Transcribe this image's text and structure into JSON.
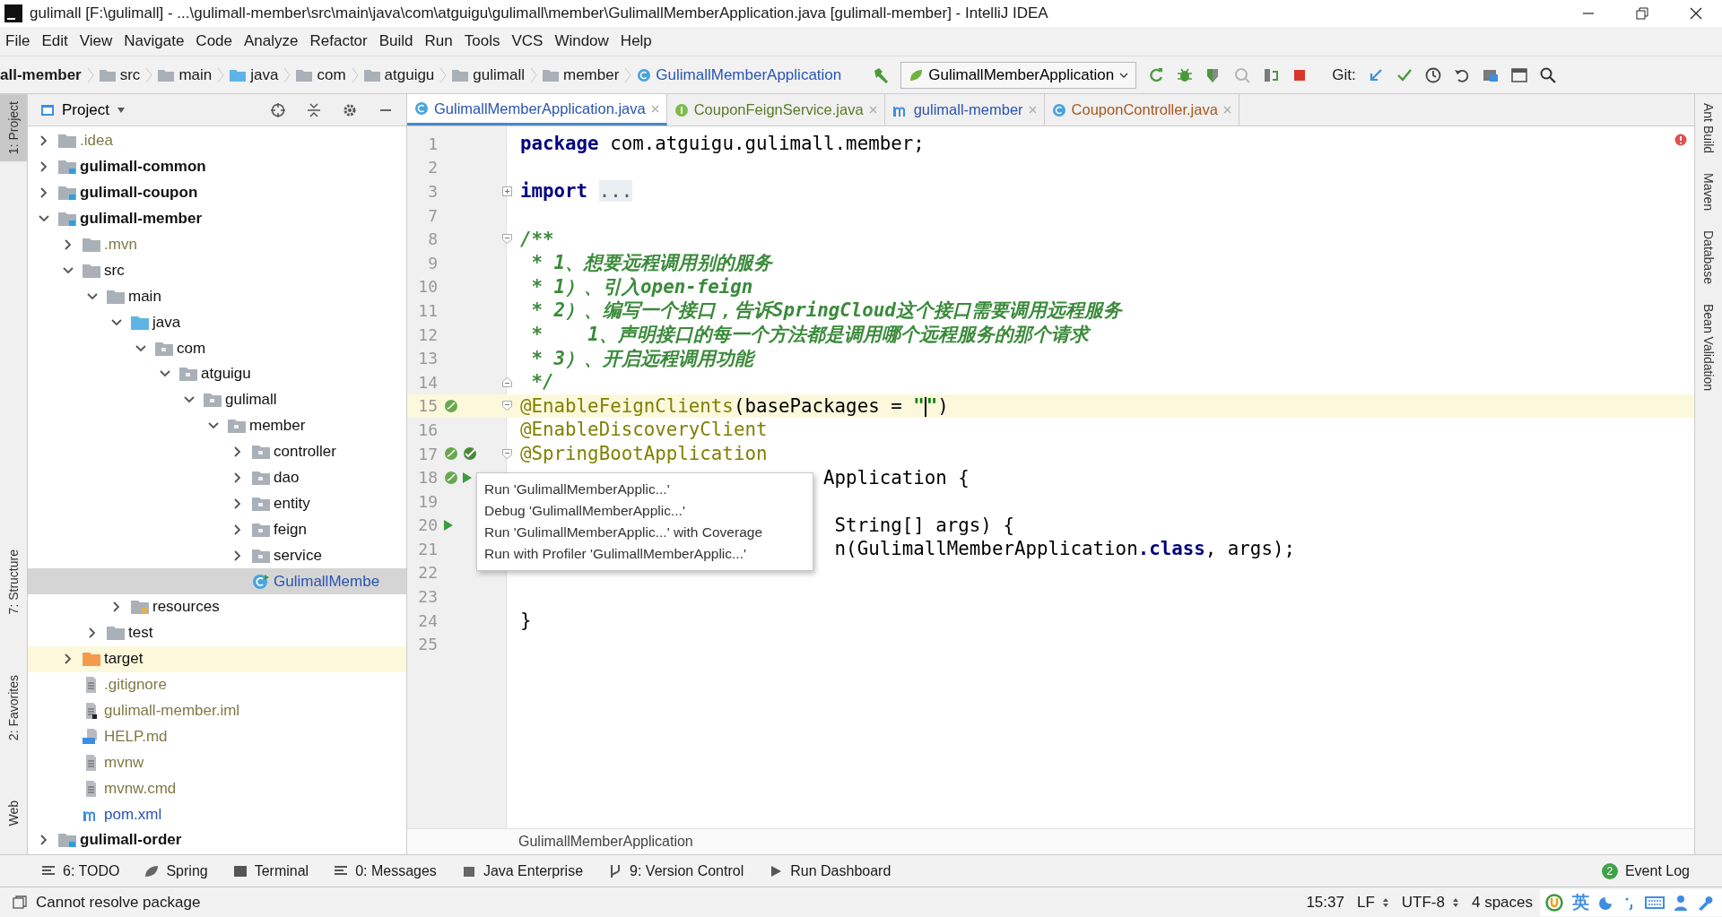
{
  "window": {
    "title": "gulimall [F:\\gulimall] - ...\\gulimall-member\\src\\main\\java\\com\\atguigu\\gulimall\\member\\GulimallMemberApplication.java [gulimall-member] - IntelliJ IDEA"
  },
  "menu": [
    "File",
    "Edit",
    "View",
    "Navigate",
    "Code",
    "Analyze",
    "Refactor",
    "Build",
    "Run",
    "Tools",
    "VCS",
    "Window",
    "Help"
  ],
  "breadcrumbs": [
    {
      "label": "all-member",
      "kind": "module"
    },
    {
      "label": "src",
      "kind": "folder"
    },
    {
      "label": "main",
      "kind": "folder"
    },
    {
      "label": "java",
      "kind": "source"
    },
    {
      "label": "com",
      "kind": "package"
    },
    {
      "label": "atguigu",
      "kind": "package"
    },
    {
      "label": "gulimall",
      "kind": "package"
    },
    {
      "label": "member",
      "kind": "package"
    },
    {
      "label": "GulimallMemberApplication",
      "kind": "class"
    }
  ],
  "run_config": "GulimallMemberApplication",
  "git_label": "Git:",
  "left_tools": [
    {
      "label": "1: Project",
      "selected": true
    },
    {
      "label": "7: Structure",
      "selected": false
    },
    {
      "label": "2: Favorites",
      "selected": false
    },
    {
      "label": "Web",
      "selected": false
    }
  ],
  "right_tools": [
    "Ant Build",
    "Maven",
    "Database",
    "Bean Validation"
  ],
  "project": {
    "title": "Project",
    "tree": [
      {
        "label": ".idea",
        "kind": "folder",
        "color": "#7f7a45",
        "expanded": false,
        "selected": false,
        "highlighted": false
      },
      {
        "label": "gulimall-common",
        "kind": "module",
        "color": "#111111",
        "expanded": false,
        "selected": false,
        "highlighted": false
      },
      {
        "label": "gulimall-coupon",
        "kind": "module",
        "color": "#111111",
        "expanded": false,
        "selected": false,
        "highlighted": false
      },
      {
        "label": "gulimall-member",
        "kind": "module",
        "color": "#111111",
        "expanded": true,
        "selected": false,
        "highlighted": false,
        "children": [
          {
            "label": ".mvn",
            "kind": "folder",
            "color": "#7f7a45",
            "expanded": false,
            "selected": false,
            "highlighted": false
          },
          {
            "label": "src",
            "kind": "folder",
            "color": "#111111",
            "expanded": true,
            "selected": false,
            "highlighted": false,
            "children": [
              {
                "label": "main",
                "kind": "folder",
                "color": "#111111",
                "expanded": true,
                "selected": false,
                "highlighted": false,
                "children": [
                  {
                    "label": "java",
                    "kind": "source",
                    "color": "#111111",
                    "expanded": true,
                    "selected": false,
                    "highlighted": false,
                    "children": [
                      {
                        "label": "com",
                        "kind": "package",
                        "color": "#111111",
                        "expanded": true,
                        "selected": false,
                        "highlighted": false,
                        "children": [
                          {
                            "label": "atguigu",
                            "kind": "package",
                            "color": "#111111",
                            "expanded": true,
                            "selected": false,
                            "highlighted": false,
                            "children": [
                              {
                                "label": "gulimall",
                                "kind": "package",
                                "color": "#111111",
                                "expanded": true,
                                "selected": false,
                                "highlighted": false,
                                "children": [
                                  {
                                    "label": "member",
                                    "kind": "package",
                                    "color": "#111111",
                                    "expanded": true,
                                    "selected": false,
                                    "highlighted": false,
                                    "children": [
                                      {
                                        "label": "controller",
                                        "kind": "package",
                                        "color": "#111111",
                                        "expanded": false,
                                        "selected": false,
                                        "highlighted": false
                                      },
                                      {
                                        "label": "dao",
                                        "kind": "package",
                                        "color": "#111111",
                                        "expanded": false,
                                        "selected": false,
                                        "highlighted": false
                                      },
                                      {
                                        "label": "entity",
                                        "kind": "package",
                                        "color": "#111111",
                                        "expanded": false,
                                        "selected": false,
                                        "highlighted": false
                                      },
                                      {
                                        "label": "feign",
                                        "kind": "package",
                                        "color": "#111111",
                                        "expanded": false,
                                        "selected": false,
                                        "highlighted": false
                                      },
                                      {
                                        "label": "service",
                                        "kind": "package",
                                        "color": "#111111",
                                        "expanded": false,
                                        "selected": false,
                                        "highlighted": false
                                      },
                                      {
                                        "label": "GulimallMembe",
                                        "kind": "class",
                                        "color": "#2a55b0",
                                        "selected": true,
                                        "highlighted": false
                                      }
                                    ]
                                  }
                                ]
                              }
                            ]
                          }
                        ]
                      }
                    ]
                  },
                  {
                    "label": "resources",
                    "kind": "resources",
                    "color": "#111111",
                    "expanded": false,
                    "selected": false,
                    "highlighted": false
                  }
                ]
              },
              {
                "label": "test",
                "kind": "folder",
                "color": "#111111",
                "expanded": false,
                "selected": false,
                "highlighted": false
              }
            ]
          },
          {
            "label": "target",
            "kind": "excluded",
            "color": "#111111",
            "expanded": false,
            "selected": false,
            "highlighted": true
          },
          {
            "label": ".gitignore",
            "kind": "file",
            "color": "#7f7a45",
            "selected": false,
            "highlighted": false
          },
          {
            "label": "gulimall-member.iml",
            "kind": "iml",
            "color": "#7f7a45",
            "selected": false,
            "highlighted": false
          },
          {
            "label": "HELP.md",
            "kind": "markdown",
            "color": "#7f7a45",
            "selected": false,
            "highlighted": false
          },
          {
            "label": "mvnw",
            "kind": "file",
            "color": "#7f7a45",
            "selected": false,
            "highlighted": false
          },
          {
            "label": "mvnw.cmd",
            "kind": "file",
            "color": "#7f7a45",
            "selected": false,
            "highlighted": false
          },
          {
            "label": "pom.xml",
            "kind": "maven",
            "color": "#2a55b0",
            "selected": false,
            "highlighted": false
          }
        ]
      },
      {
        "label": "gulimall-order",
        "kind": "module",
        "color": "#111111",
        "expanded": false,
        "selected": false,
        "highlighted": false
      }
    ]
  },
  "tabs": [
    {
      "label": "GulimallMemberApplication.java",
      "kind": "class",
      "color": "#2a55b0",
      "selected": true
    },
    {
      "label": "CouponFeignService.java",
      "kind": "interface",
      "color": "#5a7a2a",
      "selected": false
    },
    {
      "label": "gulimall-member",
      "kind": "maven",
      "color": "#2a55b0",
      "selected": false
    },
    {
      "label": "CouponController.java",
      "kind": "class",
      "color": "#a8571f",
      "selected": false
    }
  ],
  "code": [
    {
      "number": "1",
      "current": false,
      "segments": [
        {
          "kind": "keyword",
          "text": "package"
        },
        {
          "kind": "plain",
          "text": " com.atguigu.gulimall.member;"
        }
      ]
    },
    {
      "number": "2",
      "current": false
    },
    {
      "number": "3",
      "current": false,
      "segments": [
        {
          "kind": "keyword",
          "text": "import"
        },
        {
          "kind": "folded",
          "text": "..."
        }
      ]
    },
    {
      "number": "7",
      "current": false
    },
    {
      "number": "8",
      "current": false,
      "segments": [
        {
          "kind": "comment",
          "text": "/**"
        }
      ]
    },
    {
      "number": "9",
      "current": false,
      "segments": [
        {
          "kind": "comment",
          "text": " * 1、想要远程调用别的服务"
        }
      ]
    },
    {
      "number": "10",
      "current": false,
      "segments": [
        {
          "kind": "comment",
          "text": " * 1）、引入open-feign"
        }
      ]
    },
    {
      "number": "11",
      "current": false,
      "segments": [
        {
          "kind": "comment",
          "text": " * 2）、编写一个接口，告诉SpringCloud这个接口需要调用远程服务"
        }
      ]
    },
    {
      "number": "12",
      "current": false,
      "segments": [
        {
          "kind": "comment",
          "text": " *    1、声明接口的每一个方法都是调用哪个远程服务的那个请求"
        }
      ]
    },
    {
      "number": "13",
      "current": false,
      "segments": [
        {
          "kind": "comment",
          "text": " * 3）、开启远程调用功能"
        }
      ]
    },
    {
      "number": "14",
      "current": false,
      "segments": [
        {
          "kind": "comment",
          "text": " */"
        }
      ]
    },
    {
      "number": "15",
      "current": true,
      "segments": [
        {
          "kind": "annotation",
          "text": "@EnableFeignClients"
        },
        {
          "kind": "plain",
          "text": "(basePackages = "
        },
        {
          "kind": "string",
          "text": "\""
        },
        {
          "kind": "caret"
        },
        {
          "kind": "string",
          "text": "\""
        },
        {
          "kind": "plain",
          "text": ")"
        }
      ]
    },
    {
      "number": "16",
      "current": false,
      "segments": [
        {
          "kind": "annotation",
          "text": "@EnableDiscoveryClient"
        }
      ]
    },
    {
      "number": "17",
      "current": false,
      "segments": [
        {
          "kind": "annotation",
          "text": "@SpringBootApplication"
        }
      ]
    },
    {
      "number": "18",
      "current": false,
      "segments": [
        {
          "kind": "plain",
          "text": "                           Application {"
        }
      ]
    },
    {
      "number": "19",
      "current": false
    },
    {
      "number": "20",
      "current": false,
      "segments": [
        {
          "kind": "plain",
          "text": "                            String[] args) {"
        }
      ]
    },
    {
      "number": "21",
      "current": false,
      "segments": [
        {
          "kind": "plain",
          "text": "                            n(GulimallMemberApplication"
        },
        {
          "kind": "keyword",
          "text": ".class"
        },
        {
          "kind": "plain",
          "text": ", args);"
        }
      ]
    },
    {
      "number": "22",
      "current": false
    },
    {
      "number": "23",
      "current": false
    },
    {
      "number": "24",
      "current": false,
      "segments": [
        {
          "kind": "plain",
          "text": "}"
        }
      ]
    },
    {
      "number": "25",
      "current": false
    }
  ],
  "popup": [
    "Run 'GulimallMemberApplic...'",
    "Debug 'GulimallMemberApplic...'",
    "Run 'GulimallMemberApplic...' with Coverage",
    "Run with Profiler 'GulimallMemberApplic...'"
  ],
  "editor_breadcrumb": "GulimallMemberApplication",
  "bottom_tools": [
    {
      "label": "6: TODO",
      "kind": "todo"
    },
    {
      "label": "Spring",
      "kind": "spring"
    },
    {
      "label": "Terminal",
      "kind": "terminal"
    },
    {
      "label": "0: Messages",
      "kind": "messages"
    },
    {
      "label": "Java Enterprise",
      "kind": "enterprise"
    },
    {
      "label": "9: Version Control",
      "kind": "vcs"
    },
    {
      "label": "Run Dashboard",
      "kind": "run"
    }
  ],
  "event_log": {
    "label": "Event Log",
    "badge": "2"
  },
  "status_bar": {
    "message": "Cannot resolve package",
    "position": "15:37",
    "line_separator": "LF",
    "encoding": "UTF-8",
    "indent": "4 spaces",
    "ime": "英"
  }
}
